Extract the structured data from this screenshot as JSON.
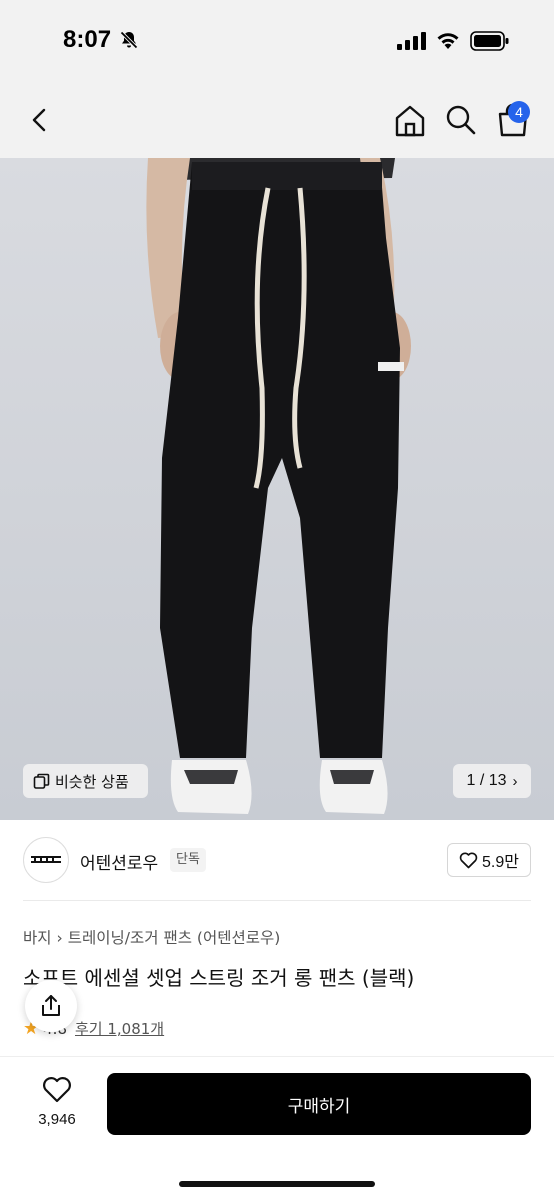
{
  "status_bar": {
    "time": "8:07"
  },
  "nav": {
    "cart_count": "4"
  },
  "image": {
    "similar_label": "비슷한 상품",
    "pager": "1 / 13"
  },
  "brand": {
    "name": "어텐션로우",
    "tag": "단독",
    "likes": "5.9만"
  },
  "breadcrumb": {
    "items": [
      "바지",
      "트레이닝/조거 팬츠 (어텐션로우)"
    ]
  },
  "product": {
    "title": "소프트 에센셜 셋업 스트링 조거 롱 팬츠 (블랙)",
    "rating": "4.8",
    "reviews": "후기 1,081개"
  },
  "bottom": {
    "wish_count": "3,946",
    "buy_label": "구매하기"
  },
  "colors": {
    "accent": "#2563eb",
    "buy_button": "#000000",
    "star": "#f5a623"
  }
}
